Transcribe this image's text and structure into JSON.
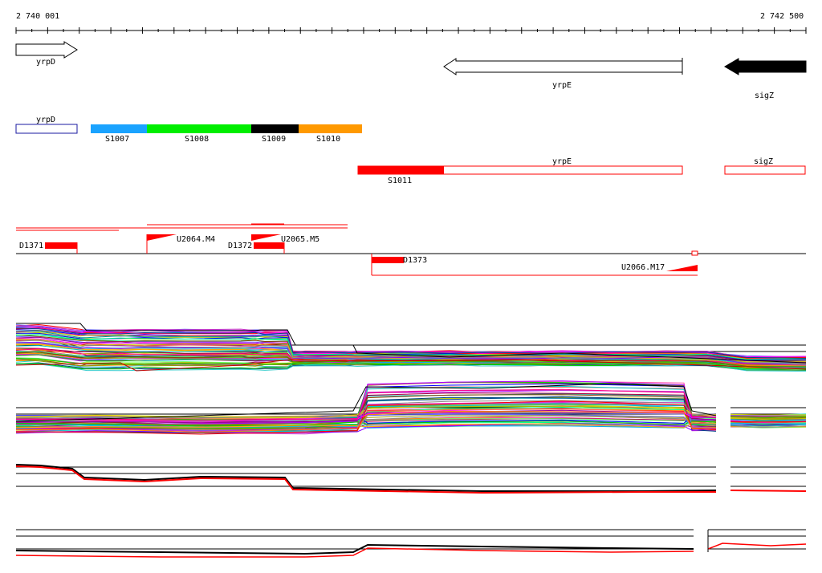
{
  "ruler": {
    "start_label": "2 740 001",
    "end_label": "2 742 500"
  },
  "genes": {
    "yrpD": "yrpD",
    "yrpE": "yrpE",
    "sigZ": "sigZ"
  },
  "segments": {
    "yrpD": "yrpD",
    "s1007": "S1007",
    "s1008": "S1008",
    "s1009": "S1009",
    "s1010": "S1010",
    "s1011": "S1011",
    "yrpE": "yrpE",
    "sigZ": "sigZ"
  },
  "features": {
    "d1371": "D1371",
    "u2064": "U2064.M4",
    "d1372": "D1372",
    "u2065": "U2065.M5",
    "d1373": "D1373",
    "u2066": "U2066.M17"
  },
  "colors": {
    "s1007": "#1aa3ff",
    "s1008": "#00ee00",
    "s1009": "#000000",
    "s1010": "#ff9900",
    "red": "#ff0000",
    "yrpD_box": "#1a1aa0"
  }
}
